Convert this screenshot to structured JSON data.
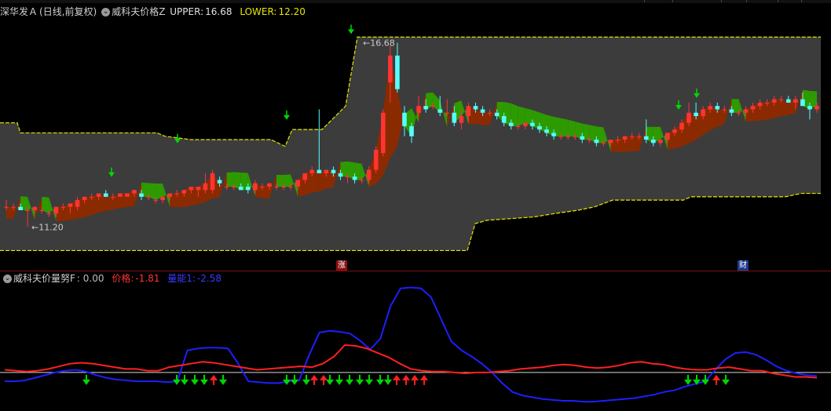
{
  "main_panel": {
    "stock_name": "深华发Ａ",
    "period_info": "(日线,前复权)",
    "indicator_name": "威科夫价格Z",
    "upper_label": "UPPER:",
    "upper_value": "16.68",
    "lower_label": "LOWER:",
    "lower_value": "12.20",
    "high_marker": "16.68",
    "low_marker": "11.20",
    "event_zhang": "涨",
    "event_cai": "财"
  },
  "sub_panel": {
    "indicator_name": "威科夫价量努F",
    "base_value": ": 0.00",
    "price_label": "价格:",
    "price_value": "-1.81",
    "volume_label": "量能1:",
    "volume_value": "-2.58"
  },
  "colors": {
    "up": "#ff3333",
    "down": "#54ffff",
    "band": "#3c3c3c",
    "bull_fill": "#8b2a00",
    "bear_fill": "#2d9b00",
    "band_line": "#e6e600",
    "price_line": "#ff2020",
    "volume_line": "#1e1eff",
    "arrow_green": "#00d800",
    "arrow_red": "#ff2020"
  },
  "chart_data": {
    "type": "candlestick",
    "price_scale": [
      10.3,
      17.3
    ],
    "candles": [
      [
        11.8,
        12.0,
        11.7,
        11.8
      ],
      [
        11.8,
        11.9,
        11.7,
        11.8
      ],
      [
        11.8,
        11.9,
        11.7,
        11.7
      ],
      [
        11.7,
        11.8,
        11.2,
        11.7
      ],
      [
        11.7,
        11.8,
        11.6,
        11.8
      ],
      [
        11.7,
        11.8,
        11.6,
        11.7
      ],
      [
        11.6,
        11.7,
        11.5,
        11.6
      ],
      [
        11.6,
        11.8,
        11.5,
        11.8
      ],
      [
        11.8,
        11.9,
        11.7,
        11.8
      ],
      [
        11.8,
        11.9,
        11.6,
        11.9
      ],
      [
        11.8,
        12.1,
        11.7,
        12.0
      ],
      [
        12.0,
        12.1,
        11.9,
        12.1
      ],
      [
        12.1,
        12.2,
        12.0,
        12.1
      ],
      [
        12.1,
        12.2,
        12.0,
        12.2
      ],
      [
        12.2,
        12.3,
        12.1,
        12.1
      ],
      [
        12.1,
        12.2,
        12.0,
        12.1
      ],
      [
        12.1,
        12.2,
        12.1,
        12.2
      ],
      [
        12.1,
        12.2,
        12.1,
        12.2
      ],
      [
        12.2,
        12.3,
        12.1,
        12.3
      ],
      [
        12.2,
        12.3,
        12.0,
        12.1
      ],
      [
        12.1,
        12.2,
        12.0,
        12.1
      ],
      [
        12.0,
        12.1,
        11.9,
        12.0
      ],
      [
        12.0,
        12.1,
        11.9,
        12.1
      ],
      [
        12.1,
        12.2,
        12.0,
        12.2
      ],
      [
        12.2,
        12.3,
        12.1,
        12.2
      ],
      [
        12.2,
        12.3,
        12.1,
        12.3
      ],
      [
        12.3,
        12.4,
        12.2,
        12.4
      ],
      [
        12.3,
        12.4,
        12.1,
        12.4
      ],
      [
        12.3,
        12.8,
        12.2,
        12.5
      ],
      [
        12.3,
        12.9,
        12.2,
        12.8
      ],
      [
        12.6,
        12.7,
        12.4,
        12.5
      ],
      [
        12.4,
        12.5,
        12.3,
        12.4
      ],
      [
        12.4,
        12.5,
        12.3,
        12.4
      ],
      [
        12.4,
        12.5,
        12.3,
        12.3
      ],
      [
        12.4,
        12.5,
        12.2,
        12.3
      ],
      [
        12.3,
        12.6,
        12.2,
        12.5
      ],
      [
        12.4,
        12.5,
        12.3,
        12.4
      ],
      [
        12.4,
        12.5,
        12.3,
        12.5
      ],
      [
        12.4,
        12.5,
        12.3,
        12.4
      ],
      [
        12.4,
        12.5,
        12.3,
        12.4
      ],
      [
        12.4,
        12.5,
        12.3,
        12.4
      ],
      [
        12.4,
        12.6,
        12.3,
        12.6
      ],
      [
        12.6,
        12.7,
        12.5,
        12.8
      ],
      [
        12.8,
        13.0,
        12.7,
        12.9
      ],
      [
        12.9,
        14.7,
        12.8,
        12.8
      ],
      [
        12.8,
        12.9,
        12.7,
        12.9
      ],
      [
        12.9,
        13.0,
        12.7,
        12.8
      ],
      [
        12.8,
        12.9,
        12.6,
        12.7
      ],
      [
        12.7,
        12.8,
        12.5,
        12.7
      ],
      [
        12.7,
        12.8,
        12.5,
        12.6
      ],
      [
        12.6,
        12.7,
        12.5,
        12.6
      ],
      [
        12.6,
        13.0,
        12.5,
        12.9
      ],
      [
        12.9,
        13.6,
        12.8,
        13.5
      ],
      [
        13.4,
        14.7,
        13.3,
        14.6
      ],
      [
        15.5,
        16.6,
        14.9,
        16.3
      ],
      [
        16.3,
        16.68,
        15.2,
        15.3
      ],
      [
        14.6,
        14.8,
        13.9,
        14.2
      ],
      [
        14.2,
        14.3,
        13.7,
        13.9
      ],
      [
        14.6,
        15.1,
        14.5,
        14.8
      ],
      [
        14.8,
        15.0,
        14.6,
        14.7
      ],
      [
        14.8,
        14.9,
        14.7,
        14.8
      ],
      [
        14.7,
        15.1,
        14.5,
        14.6
      ],
      [
        14.6,
        15.0,
        14.5,
        14.6
      ],
      [
        14.6,
        14.8,
        14.2,
        14.3
      ],
      [
        14.3,
        14.7,
        14.1,
        14.5
      ],
      [
        14.5,
        14.9,
        14.3,
        14.8
      ],
      [
        14.8,
        14.9,
        14.6,
        14.7
      ],
      [
        14.7,
        14.8,
        14.5,
        14.6
      ],
      [
        14.6,
        14.7,
        14.5,
        14.6
      ],
      [
        14.6,
        14.7,
        14.4,
        14.5
      ],
      [
        14.5,
        14.6,
        14.2,
        14.3
      ],
      [
        14.3,
        14.4,
        14.1,
        14.2
      ],
      [
        14.2,
        14.3,
        14.1,
        14.2
      ],
      [
        14.2,
        14.3,
        14.1,
        14.3
      ],
      [
        14.3,
        14.4,
        14.1,
        14.2
      ],
      [
        14.2,
        14.3,
        14.0,
        14.1
      ],
      [
        14.1,
        14.2,
        13.9,
        14.0
      ],
      [
        14.0,
        14.1,
        13.8,
        13.9
      ],
      [
        13.9,
        14.0,
        13.8,
        13.9
      ],
      [
        13.9,
        14.0,
        13.8,
        13.9
      ],
      [
        13.9,
        14.0,
        13.8,
        13.9
      ],
      [
        13.9,
        14.0,
        13.7,
        13.8
      ],
      [
        13.8,
        13.9,
        13.7,
        13.8
      ],
      [
        13.8,
        13.9,
        13.6,
        13.7
      ],
      [
        13.7,
        13.8,
        13.6,
        13.7
      ],
      [
        13.7,
        13.8,
        13.6,
        13.8
      ],
      [
        13.8,
        13.9,
        13.7,
        13.8
      ],
      [
        13.8,
        13.9,
        13.7,
        13.9
      ],
      [
        13.9,
        14.0,
        13.8,
        13.9
      ],
      [
        13.9,
        14.0,
        13.8,
        13.9
      ],
      [
        13.9,
        14.4,
        13.7,
        13.8
      ],
      [
        13.8,
        13.9,
        13.6,
        13.7
      ],
      [
        13.7,
        13.8,
        13.6,
        13.8
      ],
      [
        13.8,
        14.0,
        13.7,
        14.0
      ],
      [
        14.0,
        14.2,
        13.9,
        14.1
      ],
      [
        14.1,
        14.4,
        14.0,
        14.3
      ],
      [
        14.3,
        14.9,
        14.2,
        14.6
      ],
      [
        14.6,
        14.9,
        14.4,
        14.5
      ],
      [
        14.5,
        14.8,
        14.4,
        14.7
      ],
      [
        14.7,
        14.9,
        14.6,
        14.8
      ],
      [
        14.8,
        14.9,
        14.6,
        14.7
      ],
      [
        14.7,
        14.8,
        14.6,
        14.7
      ],
      [
        14.7,
        14.8,
        14.5,
        14.6
      ],
      [
        14.6,
        14.7,
        14.5,
        14.6
      ],
      [
        14.6,
        14.8,
        14.5,
        14.7
      ],
      [
        14.7,
        14.9,
        14.6,
        14.8
      ],
      [
        14.8,
        15.0,
        14.7,
        14.9
      ],
      [
        14.9,
        15.0,
        14.8,
        14.9
      ],
      [
        14.9,
        15.1,
        14.8,
        15.0
      ],
      [
        15.0,
        15.1,
        14.9,
        15.0
      ],
      [
        15.0,
        15.1,
        14.9,
        14.9
      ],
      [
        14.9,
        15.1,
        14.7,
        15.0
      ],
      [
        15.0,
        15.2,
        14.9,
        14.8
      ],
      [
        14.8,
        14.9,
        14.4,
        14.7
      ],
      [
        14.7,
        14.9,
        14.6,
        14.8
      ]
    ],
    "upper_band": [
      [
        0,
        14.3
      ],
      [
        20,
        14.3
      ],
      [
        22,
        14.3
      ],
      [
        26,
        14.0
      ],
      [
        128,
        14.0
      ],
      [
        200,
        14.0
      ],
      [
        210,
        13.9
      ],
      [
        243,
        13.8
      ],
      [
        329,
        13.8
      ],
      [
        345,
        13.8
      ],
      [
        363,
        13.6
      ],
      [
        372,
        14.1
      ],
      [
        410,
        14.1
      ],
      [
        440,
        14.8
      ],
      [
        455,
        16.85
      ],
      [
        470,
        16.85
      ],
      [
        1045,
        16.85
      ]
    ],
    "lower_band": [
      [
        0,
        10.5
      ],
      [
        365,
        10.5
      ],
      [
        595,
        10.5
      ],
      [
        605,
        11.3
      ],
      [
        620,
        11.4
      ],
      [
        680,
        11.5
      ],
      [
        706,
        11.6
      ],
      [
        736,
        11.7
      ],
      [
        757,
        11.8
      ],
      [
        780,
        12.0
      ],
      [
        870,
        12.0
      ],
      [
        880,
        12.1
      ],
      [
        1000,
        12.1
      ],
      [
        1020,
        12.2
      ],
      [
        1045,
        12.2
      ]
    ],
    "wick_lines": [],
    "sub_axis": [
      -4.0,
      10.0
    ],
    "price_series": [
      0.3,
      0.2,
      0.1,
      0.2,
      0.4,
      0.7,
      1.0,
      1.1,
      1.0,
      0.8,
      0.6,
      0.4,
      0.4,
      0.2,
      0.2,
      0.6,
      0.8,
      1.0,
      1.2,
      1.1,
      0.9,
      0.7,
      0.5,
      0.3,
      0.4,
      0.5,
      0.6,
      0.7,
      0.6,
      1.0,
      1.8,
      3.1,
      3.0,
      2.7,
      2.2,
      1.7,
      1.0,
      0.4,
      0.2,
      0.1,
      0.1,
      0.0,
      -0.1,
      0.0,
      0.0,
      0.1,
      0.2,
      0.4,
      0.5,
      0.6,
      0.8,
      0.9,
      0.8,
      0.6,
      0.5,
      0.6,
      0.8,
      1.1,
      1.2,
      1.0,
      0.9,
      0.6,
      0.4,
      0.3,
      0.3,
      0.5,
      0.6,
      0.4,
      0.2,
      0.2,
      -0.1,
      -0.3,
      -0.5,
      -0.5,
      -0.6
    ],
    "volume_series": [
      -1.0,
      -1.0,
      -0.9,
      -0.6,
      -0.3,
      0.0,
      0.2,
      0.3,
      0.1,
      -0.3,
      -0.6,
      -0.8,
      -0.9,
      -1.0,
      -1.0,
      -1.0,
      -1.1,
      -1.0,
      2.5,
      2.7,
      2.8,
      2.8,
      2.7,
      1.0,
      -1.0,
      -1.1,
      -1.2,
      -1.2,
      -1.0,
      -0.9,
      2.0,
      4.5,
      4.7,
      4.6,
      4.4,
      3.6,
      2.6,
      3.8,
      7.5,
      9.5,
      9.6,
      9.5,
      8.5,
      6.0,
      3.5,
      2.5,
      1.8,
      1.0,
      0.0,
      -1.2,
      -2.2,
      -2.6,
      -2.8,
      -3.0,
      -3.1,
      -3.2,
      -3.2,
      -3.3,
      -3.3,
      -3.2,
      -3.1,
      -3.0,
      -2.9,
      -2.7,
      -2.5,
      -2.2,
      -2.0,
      -1.6,
      -1.3,
      -1.0,
      0.3,
      1.5,
      2.2,
      2.3,
      2.0,
      1.4,
      0.7,
      0.2,
      -0.1,
      -0.3,
      -0.4
    ],
    "green_arrows": [
      110,
      225,
      235,
      248,
      260,
      284,
      365,
      375,
      390,
      420,
      432,
      445,
      458,
      470,
      484,
      494,
      876,
      887,
      898,
      924
    ],
    "red_arrows": [
      272,
      400,
      412,
      505,
      517,
      528,
      540,
      912
    ]
  }
}
